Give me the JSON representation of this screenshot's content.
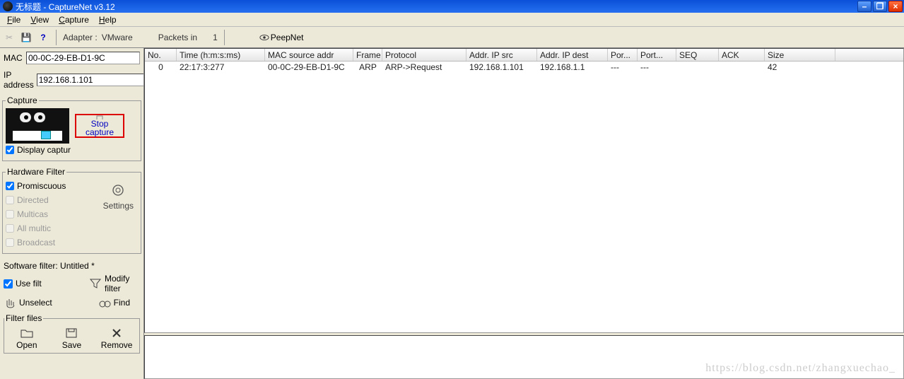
{
  "window": {
    "title": "无标题 - CaptureNet  v3.12"
  },
  "menu": {
    "file": "File",
    "view": "View",
    "capture": "Capture",
    "help": "Help"
  },
  "toolbar": {
    "adapter_label": "Adapter : ",
    "adapter_value": "VMware",
    "packets_label": "Packets in",
    "packets_value": "1",
    "peepnet": "PeepNet"
  },
  "left": {
    "mac_label": "MAC",
    "mac_value": "00-0C-29-EB-D1-9C",
    "ip_label": "IP address",
    "ip_value": "192.168.1.101",
    "capture_legend": "Capture",
    "stop_line1": "Stop",
    "stop_line2": "capture",
    "display_capture": "Display captur",
    "hf_legend": "Hardware Filter",
    "hf_promiscuous": "Promiscuous",
    "hf_directed": "Directed",
    "hf_multicas": "Multicas",
    "hf_allmulti": "All multic",
    "hf_broadcast": "Broadcast",
    "hf_settings": "Settings",
    "sf_legend": "Software filter:",
    "sf_name": "Untitled *",
    "sf_usefilt": "Use filt",
    "sf_modify": "Modify filter",
    "sf_unselect": "Unselect",
    "sf_find": "Find",
    "ff_legend": "Filter files",
    "ff_open": "Open",
    "ff_save": "Save",
    "ff_remove": "Remove"
  },
  "columns": {
    "widths": [
      45,
      125,
      125,
      41,
      119,
      100,
      100,
      42,
      55,
      60,
      65,
      100
    ],
    "headers": [
      "No.",
      "Time (h:m:s:ms)",
      "MAC source addr",
      "Frame",
      "Protocol",
      "Addr. IP src",
      "Addr. IP dest",
      "Por...",
      "Port...",
      "SEQ",
      "ACK",
      "Size"
    ]
  },
  "rows": [
    {
      "cells": [
        "0",
        "22:17:3:277",
        "00-0C-29-EB-D1-9C",
        "ARP",
        "ARP->Request",
        "192.168.1.101",
        "192.168.1.1",
        "---",
        "---",
        "",
        "",
        "42"
      ]
    }
  ],
  "watermark": "https://blog.csdn.net/zhangxuechao_"
}
